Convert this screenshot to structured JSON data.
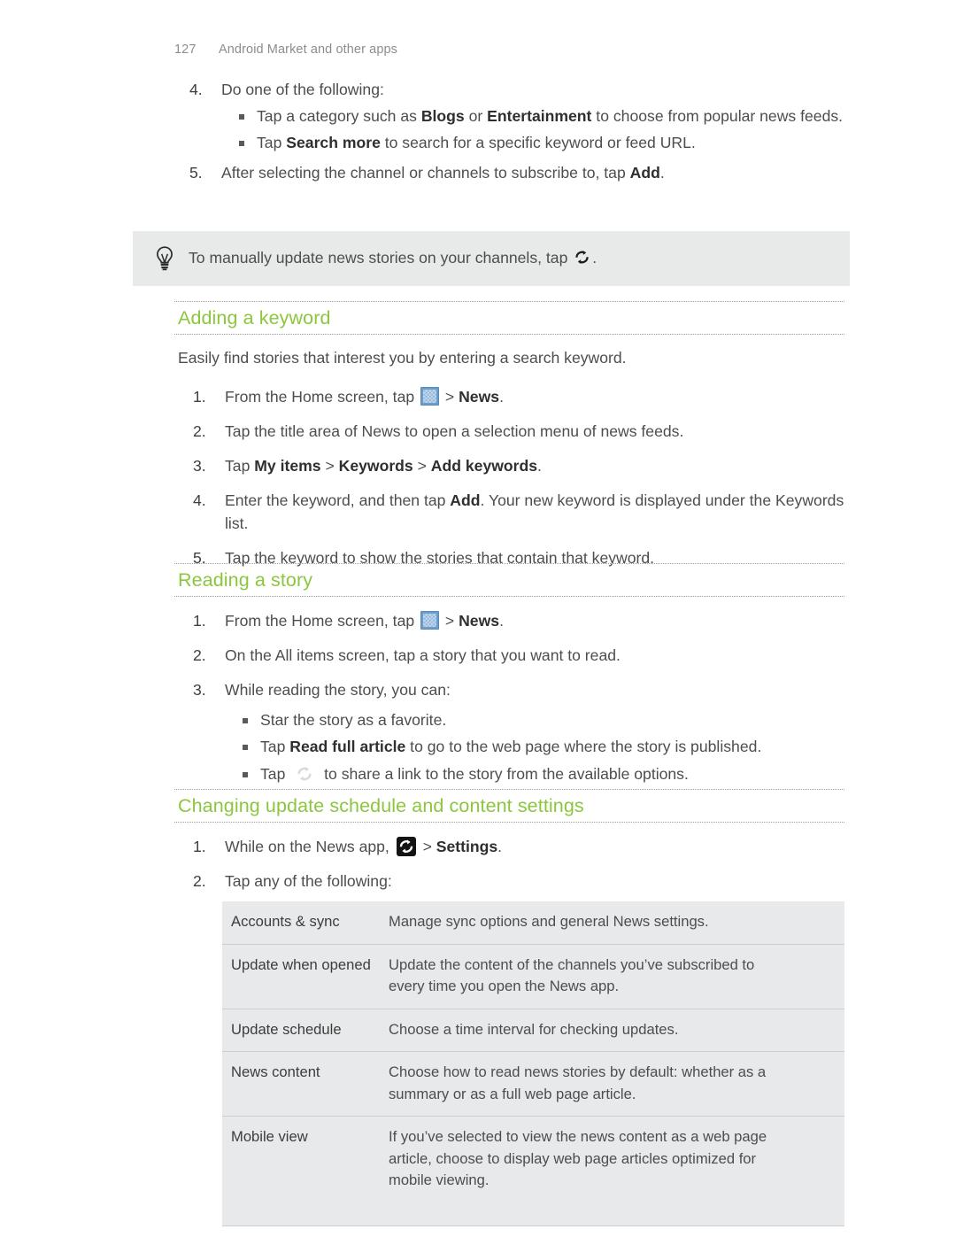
{
  "header": {
    "page_number": "127",
    "chapter_title": "Android Market and other apps"
  },
  "top_steps": {
    "step4": {
      "num": "4.",
      "text": "Do one of the following:"
    },
    "bullets": [
      {
        "pre": "Tap a category such as ",
        "b1": "Blogs",
        "mid": " or ",
        "b2": "Entertainment",
        "post": " to choose from popular news feeds."
      },
      {
        "pre": "Tap ",
        "b1": "Search more",
        "post": " to search for a specific keyword or feed URL."
      }
    ],
    "step5": {
      "num": "5.",
      "pre": "After selecting the channel or channels to subscribe to, tap ",
      "bold": "Add",
      "post": "."
    }
  },
  "tip": {
    "icon": "lightbulb-icon",
    "pre": "To manually update news stories on your channels, tap ",
    "icon_inline": "refresh-icon",
    "post": "."
  },
  "sections": [
    {
      "heading": "Adding a keyword",
      "lead": "Easily find stories that interest you by entering a search keyword.",
      "steps": [
        {
          "num": "1.",
          "pre": "From the Home screen, tap ",
          "icon": "app-drawer-icon",
          "mid": " > ",
          "bold": "News",
          "post": "."
        },
        {
          "num": "2.",
          "text": "Tap the title area of News to open a selection menu of news feeds."
        },
        {
          "num": "3.",
          "pre": "Tap ",
          "b1": "My items",
          "s1": " > ",
          "b2": "Keywords",
          "s2": " > ",
          "b3": "Add keywords",
          "post": "."
        },
        {
          "num": "4.",
          "pre": "Enter the keyword, and then tap ",
          "bold": "Add",
          "post": ". Your new keyword is displayed under the Keywords list."
        },
        {
          "num": "5.",
          "text": "Tap the keyword to show the stories that contain that keyword."
        }
      ]
    },
    {
      "heading": "Reading a story",
      "steps": [
        {
          "num": "1.",
          "pre": "From the Home screen, tap ",
          "icon": "app-drawer-icon",
          "mid": " > ",
          "bold": "News",
          "post": "."
        },
        {
          "num": "2.",
          "text": "On the All items screen, tap a story that you want to read."
        },
        {
          "num": "3.",
          "text": "While reading the story, you can:"
        }
      ],
      "bullets": [
        {
          "text": "Star the story as a favorite."
        },
        {
          "pre": "Tap ",
          "bold": "Read full article",
          "post": " to go to the web page where the story is published."
        },
        {
          "pre": "Tap ",
          "icon": "share-icon",
          "post": " to share a link to the story from the available options."
        }
      ]
    },
    {
      "heading": "Changing update schedule and content settings",
      "steps": [
        {
          "num": "1.",
          "pre": "While on the News app, ",
          "icon": "refresh-button-icon",
          "mid": " > ",
          "bold": "Settings",
          "post": "."
        },
        {
          "num": "2.",
          "text": "Tap any of the following:"
        }
      ]
    }
  ],
  "settings_table": {
    "rows": [
      {
        "key": "Accounts & sync",
        "key_lines": [
          "Accounts & sync"
        ],
        "value_lines": [
          "Manage sync options and general News settings."
        ]
      },
      {
        "key": "Update when opened",
        "key_lines": [
          "Update when",
          "opened"
        ],
        "value_lines": [
          "Update the content of the channels you’ve subscribed to",
          "every time you open the News app."
        ]
      },
      {
        "key": "Update schedule",
        "key_lines": [
          "Update schedule"
        ],
        "value_lines": [
          "Choose a time interval for checking updates."
        ]
      },
      {
        "key": "News content",
        "key_lines": [
          "News content"
        ],
        "value_lines": [
          "Choose how to read news stories by default: whether as a",
          "summary or as a full web page article."
        ]
      },
      {
        "key": "Mobile view",
        "key_lines": [
          "Mobile view"
        ],
        "value_lines": [
          "If you’ve selected to view the news content as a web page",
          "article, choose to display web page articles optimized for",
          "mobile viewing."
        ]
      }
    ]
  },
  "colors": {
    "heading_green": "#8cc63e",
    "tip_background": "#e8e9e9",
    "table_background": "#e8e9ea",
    "body_text": "#4d4d4d",
    "header_text": "#8d8d8d",
    "app_drawer_blue": "#6d9ecb"
  }
}
